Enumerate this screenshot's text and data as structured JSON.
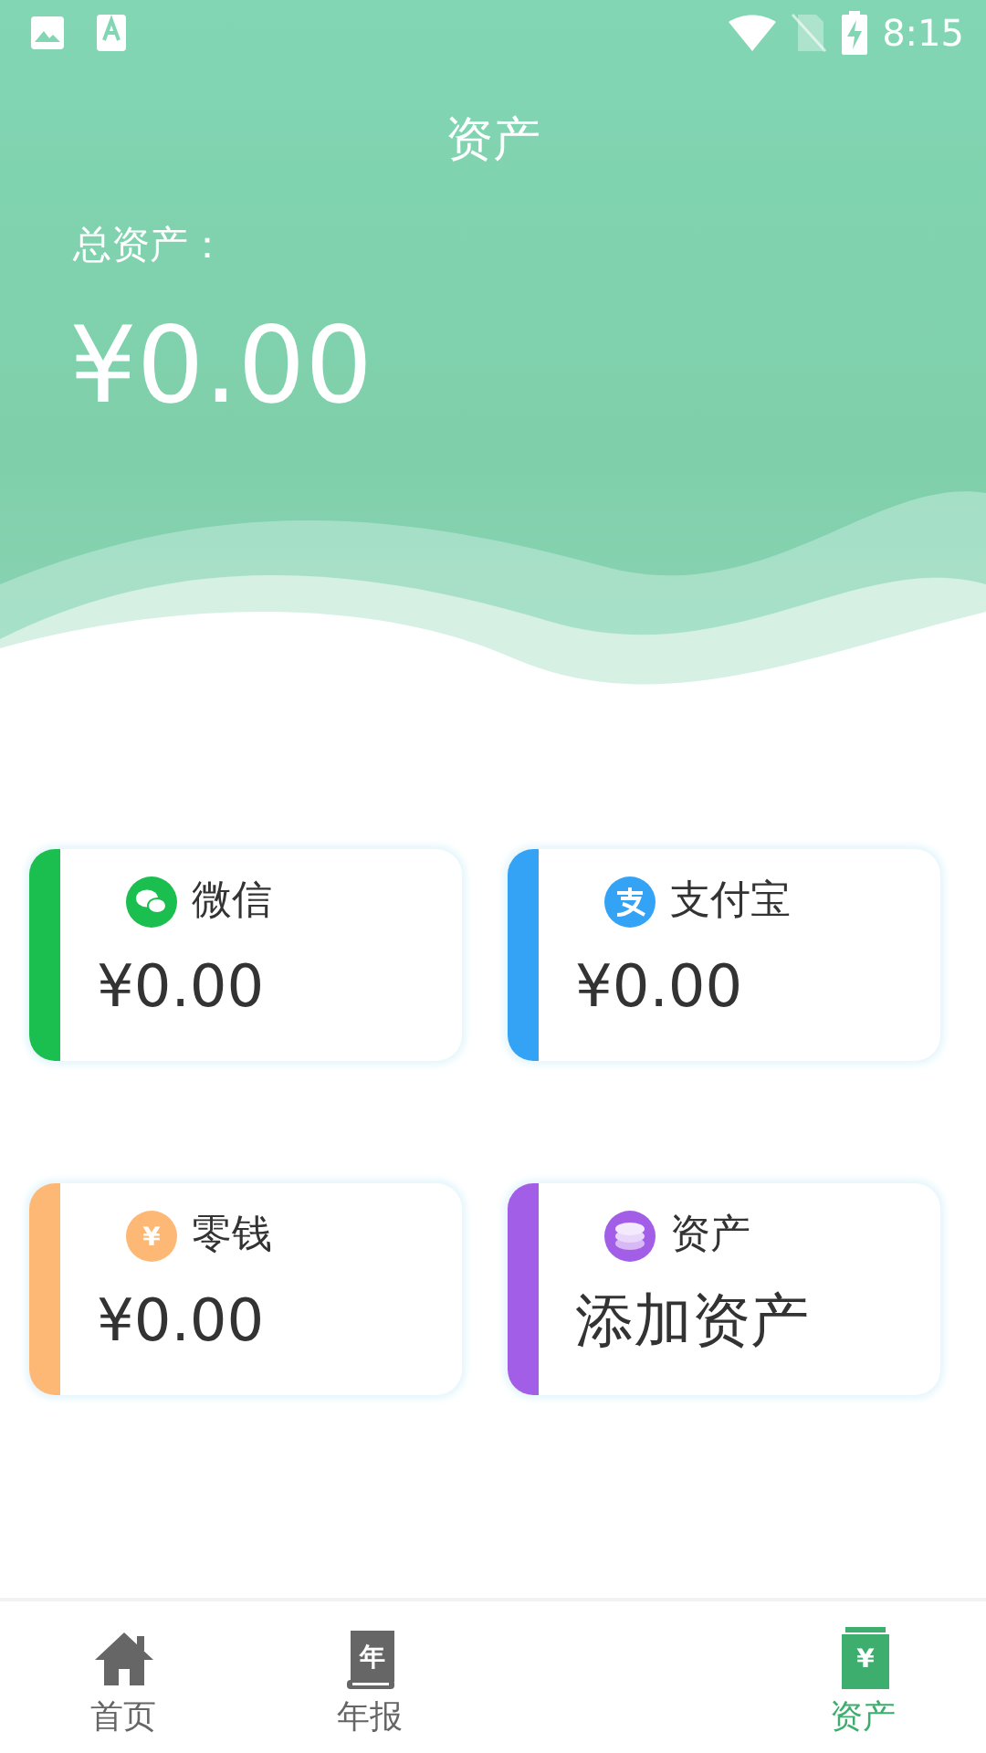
{
  "status_bar": {
    "time": "8:15"
  },
  "header": {
    "title": "资产",
    "total_label": "总资产：",
    "total_value": "¥0.00"
  },
  "accounts": [
    {
      "kind": "wechat",
      "name": "微信",
      "value": "¥0.00",
      "color": "#1bbf4f"
    },
    {
      "kind": "alipay",
      "name": "支付宝",
      "value": "¥0.00",
      "color": "#35a3f5"
    },
    {
      "kind": "cash",
      "name": "零钱",
      "value": "¥0.00",
      "color": "#fdb876",
      "icon_text": "¥"
    },
    {
      "kind": "asset",
      "name": "资产",
      "value": "添加资产",
      "color": "#a35ee8"
    }
  ],
  "tabs": [
    {
      "kind": "home",
      "label": "首页",
      "selected": false
    },
    {
      "kind": "report",
      "label": "年报",
      "selected": false,
      "icon_text": "年"
    },
    {
      "kind": "asset",
      "label": "资产",
      "selected": true,
      "icon_text": "¥"
    }
  ]
}
